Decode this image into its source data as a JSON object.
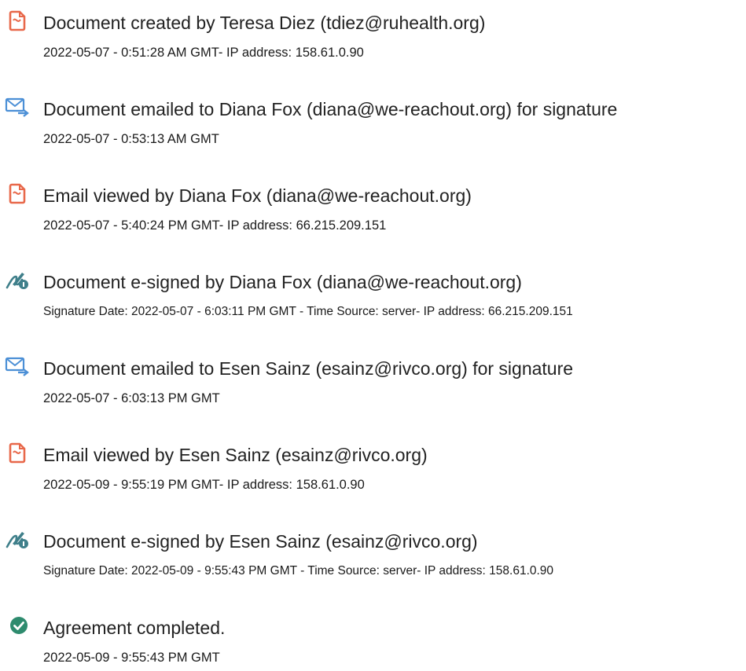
{
  "events": [
    {
      "icon": "document-created-icon",
      "title": "Document created by Teresa Diez (tdiez@ruhealth.org)",
      "detail": "2022-05-07 - 0:51:28 AM GMT- IP address: 158.61.0.90"
    },
    {
      "icon": "email-sent-icon",
      "title": "Document emailed to Diana Fox (diana@we-reachout.org) for signature",
      "detail": "2022-05-07 - 0:53:13 AM GMT"
    },
    {
      "icon": "email-viewed-icon",
      "title": "Email viewed by Diana Fox (diana@we-reachout.org)",
      "detail": "2022-05-07 - 5:40:24 PM GMT- IP address: 66.215.209.151"
    },
    {
      "icon": "esign-icon",
      "title": "Document e-signed by Diana Fox (diana@we-reachout.org)",
      "detail": "Signature Date: 2022-05-07 - 6:03:11 PM GMT - Time Source: server- IP address: 66.215.209.151"
    },
    {
      "icon": "email-sent-icon",
      "title": "Document emailed to Esen Sainz (esainz@rivco.org) for signature",
      "detail": "2022-05-07 - 6:03:13 PM GMT"
    },
    {
      "icon": "email-viewed-icon",
      "title": "Email viewed by Esen Sainz (esainz@rivco.org)",
      "detail": "2022-05-09 - 9:55:19 PM GMT- IP address: 158.61.0.90"
    },
    {
      "icon": "esign-icon",
      "title": "Document e-signed by Esen Sainz (esainz@rivco.org)",
      "detail": "Signature Date: 2022-05-09 - 9:55:43 PM GMT - Time Source: server- IP address: 158.61.0.90"
    },
    {
      "icon": "agreement-completed-icon",
      "title": "Agreement completed.",
      "detail": "2022-05-09 - 9:55:43 PM GMT"
    }
  ],
  "colors": {
    "document_icon": "#e8684a",
    "email_icon": "#4b8fd6",
    "esign_icon": "#3f7f8a",
    "completed_icon": "#2e8b6e"
  }
}
